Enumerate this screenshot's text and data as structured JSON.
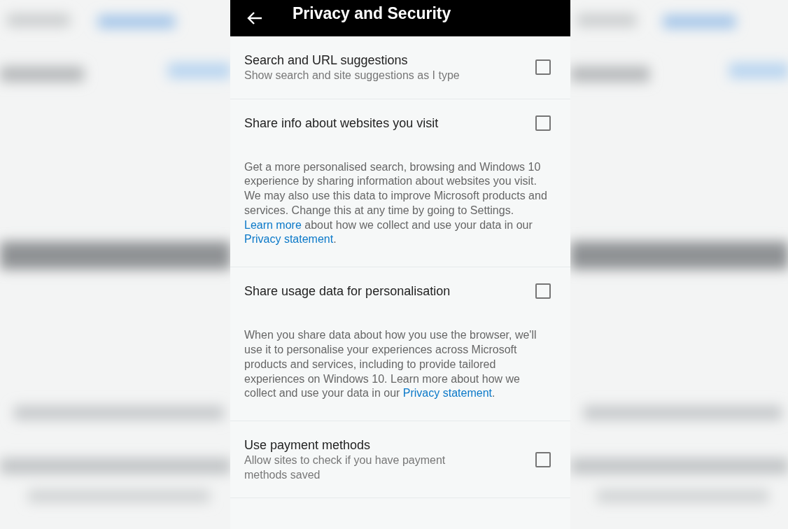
{
  "header": {
    "title": "Privacy and Security"
  },
  "settings": [
    {
      "title": "Search and URL suggestions",
      "subtitle": "Show search and site suggestions as I type",
      "checked": false
    },
    {
      "title": "Share info about websites you visit",
      "checked": false,
      "description": [
        {
          "kind": "plain",
          "text": "Get a more personalised search, browsing and Windows 10 experience by sharing information about websites you visit. We may also use this data to improve Microsoft products and services. Change this at any time by going to Settings. "
        },
        {
          "kind": "link",
          "text": "Learn more"
        },
        {
          "kind": "plain",
          "text": " about how we collect and use your data in our "
        },
        {
          "kind": "link",
          "text": "Privacy statement"
        },
        {
          "kind": "plain",
          "text": "."
        }
      ]
    },
    {
      "title": "Share usage data for personalisation",
      "checked": false,
      "description": [
        {
          "kind": "plain",
          "text": "When you share data about how you use the browser, we'll use it to personalise your experiences across Microsoft products and services, including to provide tailored experiences on Windows 10. Learn more about how we collect and use your data in our "
        },
        {
          "kind": "link",
          "text": "Privacy statement"
        },
        {
          "kind": "plain",
          "text": "."
        }
      ]
    },
    {
      "title": "Use payment methods",
      "subtitle": "Allow sites to check if you have payment methods saved",
      "checked": false
    }
  ]
}
